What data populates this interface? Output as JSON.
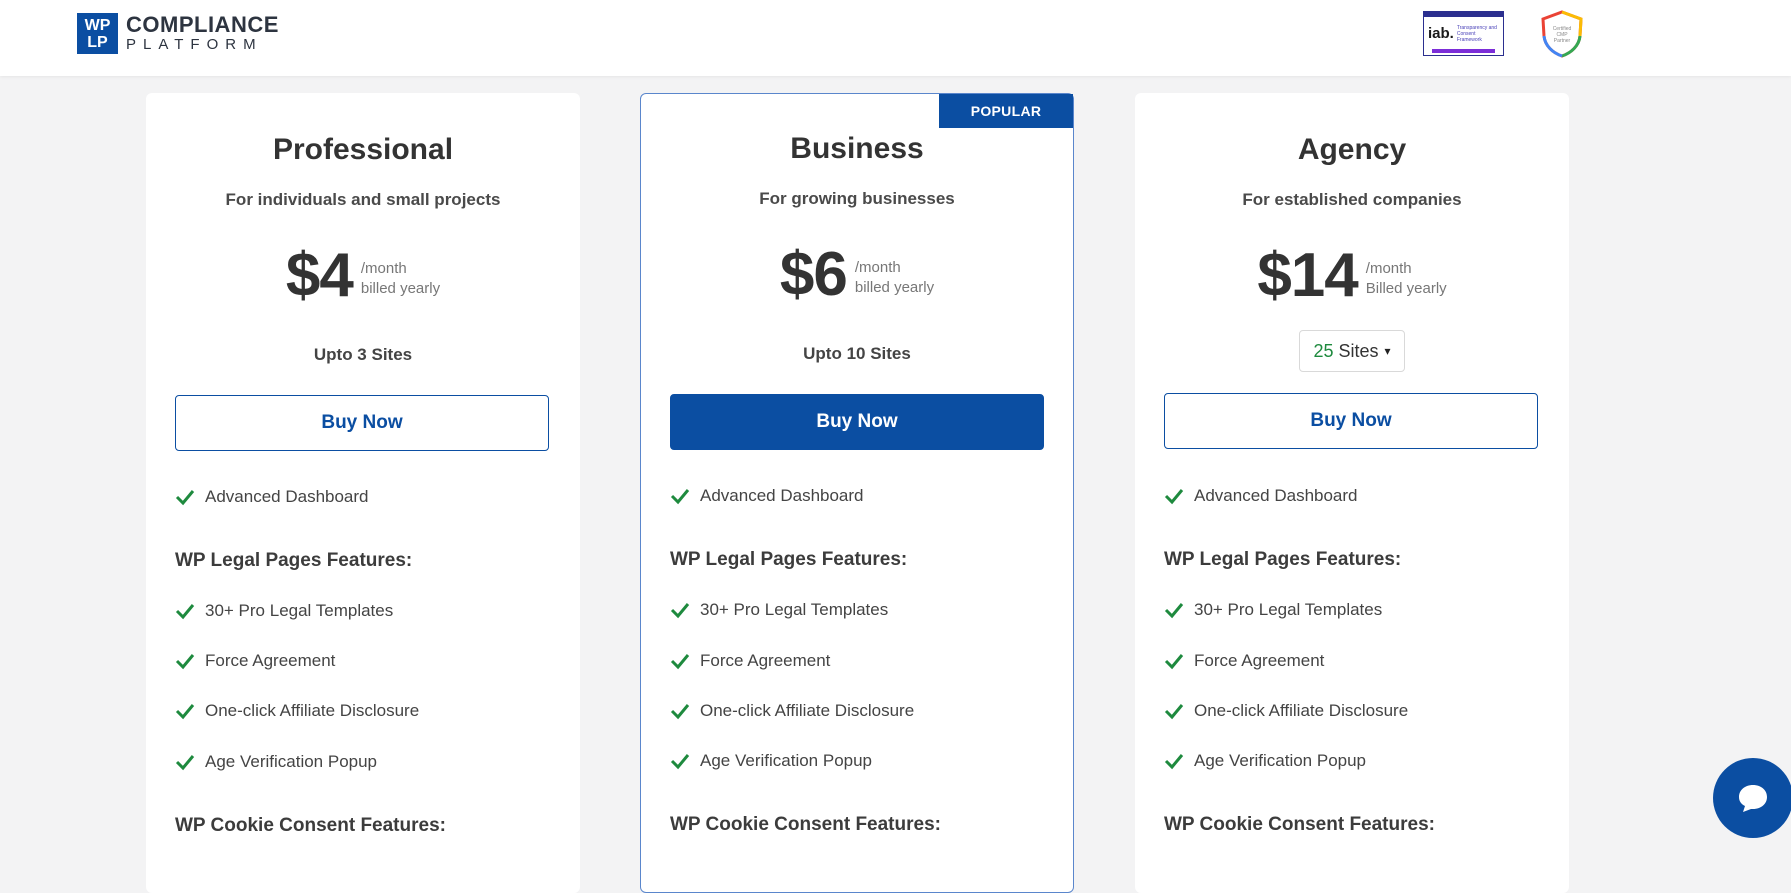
{
  "header": {
    "logo_mark_top": "WP",
    "logo_mark_bottom": "LP",
    "logo_line1": "COMPLIANCE",
    "logo_line2": "PLATFORM",
    "iab_badge": {
      "main": "iab.",
      "caption": "Transparency and Consent Framework"
    },
    "cmp_badge": {
      "caption": "Certified CMP Partner"
    }
  },
  "plans": [
    {
      "title": "Professional",
      "subtitle": "For individuals and small projects",
      "price": "$4",
      "period": "/month",
      "billing": "billed yearly",
      "sites": "Upto 3 Sites",
      "buy_label": "Buy Now",
      "feature_main": "Advanced Dashboard",
      "legal_heading": "WP Legal Pages Features:",
      "legal_features": [
        "30+ Pro Legal Templates",
        "Force Agreement",
        "One-click Affiliate Disclosure",
        "Age Verification Popup"
      ],
      "cookie_heading": "WP Cookie Consent Features:"
    },
    {
      "title": "Business",
      "subtitle": "For growing businesses",
      "price": "$6",
      "period": "/month",
      "billing": "billed yearly",
      "sites": "Upto 10 Sites",
      "buy_label": "Buy Now",
      "popular_label": "POPULAR",
      "feature_main": "Advanced Dashboard",
      "legal_heading": "WP Legal Pages Features:",
      "legal_features": [
        "30+ Pro Legal Templates",
        "Force Agreement",
        "One-click Affiliate Disclosure",
        "Age Verification Popup"
      ],
      "cookie_heading": "WP Cookie Consent Features:"
    },
    {
      "title": "Agency",
      "subtitle": "For established companies",
      "price": "$14",
      "period": "/month",
      "billing": "Billed yearly",
      "sites_select": {
        "number": "25",
        "label": "Sites",
        "caret": "▾"
      },
      "buy_label": "Buy Now",
      "feature_main": "Advanced Dashboard",
      "legal_heading": "WP Legal Pages Features:",
      "legal_features": [
        "30+ Pro Legal Templates",
        "Force Agreement",
        "One-click Affiliate Disclosure",
        "Age Verification Popup"
      ],
      "cookie_heading": "WP Cookie Consent Features:"
    }
  ],
  "colors": {
    "brand": "#0b4ea2",
    "check": "#1e8a3e",
    "background": "#f3f3f4"
  },
  "icons": {
    "feature": "check-icon",
    "chat": "chat-bubble-icon"
  }
}
